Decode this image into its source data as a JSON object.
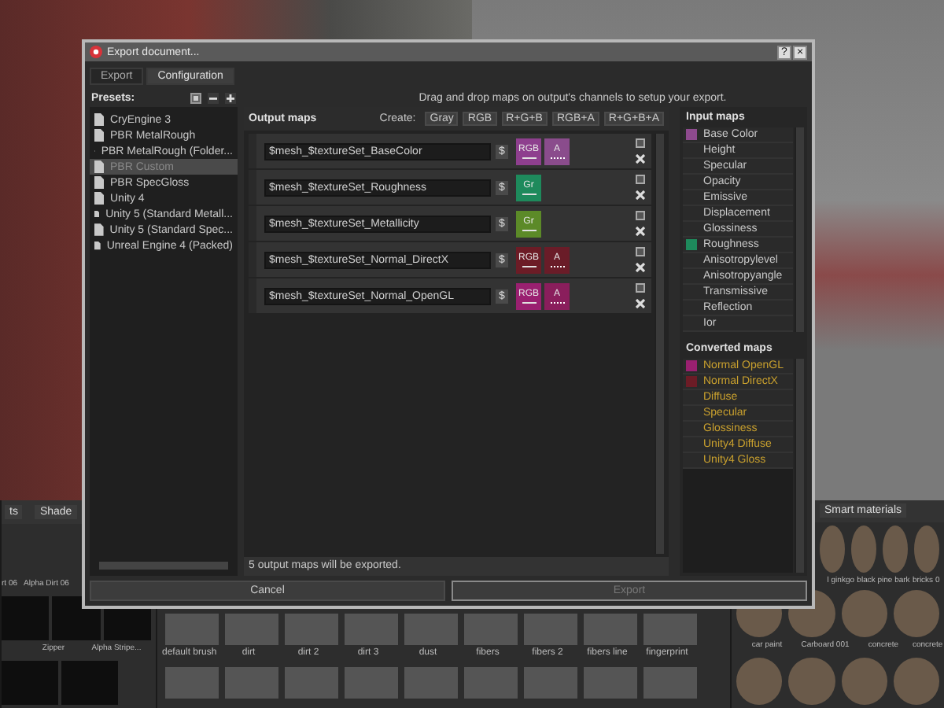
{
  "shelves": [
    {
      "tabs": [
        "ts",
        "Shade"
      ],
      "rows": [
        [
          "rt 06",
          "Alpha Dirt 06"
        ],
        [
          "",
          "Zipper",
          "Alpha Stripe..."
        ]
      ]
    },
    {
      "rows": [
        [
          "default brush",
          "dirt",
          "dirt 2",
          "dirt 3",
          "dust",
          "fibers",
          "fibers 2",
          "fibers line",
          "fingerprint"
        ]
      ]
    },
    {
      "tabs": [
        "Smart materials"
      ],
      "rows": [
        [
          "",
          "l ginkgo",
          "black pine bark",
          "bricks 0"
        ],
        [
          "car paint",
          "Carboard 001",
          "concrete",
          "concrete"
        ]
      ]
    }
  ],
  "dialog": {
    "title": "Export document...",
    "title_buttons": [
      "?",
      "×"
    ],
    "tabs": [
      {
        "label": "Export",
        "selected": false
      },
      {
        "label": "Configuration",
        "selected": true
      }
    ],
    "presets": {
      "title": "Presets:",
      "items": [
        {
          "label": "CryEngine 3",
          "selected": false
        },
        {
          "label": "PBR MetalRough",
          "selected": false
        },
        {
          "label": "PBR MetalRough (Folder...",
          "selected": false
        },
        {
          "label": "PBR Custom",
          "selected": true
        },
        {
          "label": "PBR SpecGloss",
          "selected": false
        },
        {
          "label": "Unity 4",
          "selected": false
        },
        {
          "label": "Unity 5 (Standard Metall...",
          "selected": false
        },
        {
          "label": "Unity 5 (Standard Spec...",
          "selected": false
        },
        {
          "label": "Unreal Engine 4 (Packed)",
          "selected": false
        }
      ]
    },
    "hint": "Drag and drop maps on output's channels to setup your export.",
    "output_maps": {
      "title": "Output maps",
      "create_label": "Create:",
      "create_buttons": [
        "Gray",
        "RGB",
        "R+G+B",
        "RGB+A",
        "R+G+B+A"
      ],
      "rows": [
        {
          "name": "$mesh_$textureSet_BaseColor",
          "var_button": "$",
          "channels": [
            {
              "label": "RGB",
              "kind": "rgb",
              "color": "#8e3f8e"
            },
            {
              "label": "A",
              "kind": "alpha",
              "color": "#8a4c8c"
            }
          ]
        },
        {
          "name": "$mesh_$textureSet_Roughness",
          "var_button": "$",
          "channels": [
            {
              "label": "Gr",
              "kind": "gray",
              "color": "#1e8a5c"
            }
          ]
        },
        {
          "name": "$mesh_$textureSet_Metallicity",
          "var_button": "$",
          "channels": [
            {
              "label": "Gr",
              "kind": "gray",
              "color": "#5c8a28"
            }
          ]
        },
        {
          "name": "$mesh_$textureSet_Normal_DirectX",
          "var_button": "$",
          "channels": [
            {
              "label": "RGB",
              "kind": "rgb",
              "color": "#6c1c26"
            },
            {
              "label": "A",
              "kind": "alpha",
              "color": "#6a1c28"
            }
          ]
        },
        {
          "name": "$mesh_$textureSet_Normal_OpenGL",
          "var_button": "$",
          "channels": [
            {
              "label": "RGB",
              "kind": "rgb",
              "color": "#9a2070"
            },
            {
              "label": "A",
              "kind": "alpha",
              "color": "#8a1e5c"
            }
          ]
        }
      ],
      "status": "5 output maps will be exported."
    },
    "input_maps": {
      "title": "Input maps",
      "items": [
        {
          "label": "Base Color",
          "color": "#8e4a8e"
        },
        {
          "label": "Height"
        },
        {
          "label": "Specular"
        },
        {
          "label": "Opacity"
        },
        {
          "label": "Emissive"
        },
        {
          "label": "Displacement"
        },
        {
          "label": "Glossiness"
        },
        {
          "label": "Roughness",
          "color": "#1e8a5c"
        },
        {
          "label": "Anisotropylevel"
        },
        {
          "label": "Anisotropyangle"
        },
        {
          "label": "Transmissive"
        },
        {
          "label": "Reflection"
        },
        {
          "label": "Ior"
        }
      ]
    },
    "converted_maps": {
      "title": "Converted maps",
      "items": [
        {
          "label": "Normal OpenGL",
          "color": "#9a2070"
        },
        {
          "label": "Normal DirectX",
          "color": "#6c1c26"
        },
        {
          "label": "Diffuse"
        },
        {
          "label": "Specular"
        },
        {
          "label": "Glossiness"
        },
        {
          "label": "Unity4 Diffuse"
        },
        {
          "label": "Unity4 Gloss"
        }
      ]
    },
    "buttons": [
      {
        "label": "Cancel",
        "disabled": false
      },
      {
        "label": "Export",
        "disabled": true
      }
    ]
  }
}
